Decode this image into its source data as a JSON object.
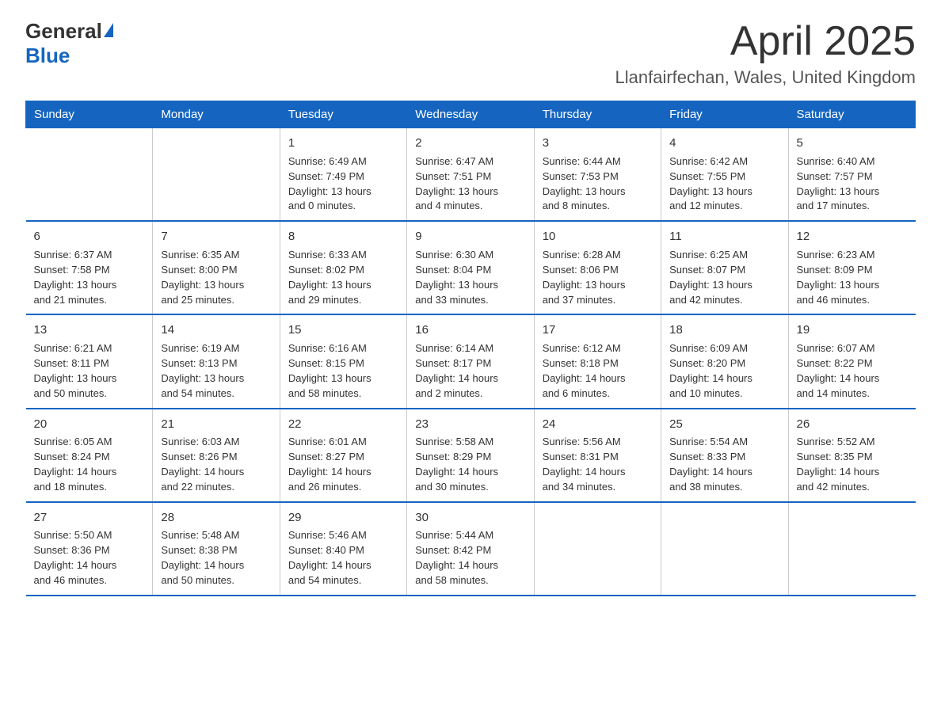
{
  "logo": {
    "general": "General",
    "blue": "Blue"
  },
  "header": {
    "month": "April 2025",
    "location": "Llanfairfechan, Wales, United Kingdom"
  },
  "weekdays": [
    "Sunday",
    "Monday",
    "Tuesday",
    "Wednesday",
    "Thursday",
    "Friday",
    "Saturday"
  ],
  "weeks": [
    [
      {
        "day": "",
        "info": ""
      },
      {
        "day": "",
        "info": ""
      },
      {
        "day": "1",
        "info": "Sunrise: 6:49 AM\nSunset: 7:49 PM\nDaylight: 13 hours\nand 0 minutes."
      },
      {
        "day": "2",
        "info": "Sunrise: 6:47 AM\nSunset: 7:51 PM\nDaylight: 13 hours\nand 4 minutes."
      },
      {
        "day": "3",
        "info": "Sunrise: 6:44 AM\nSunset: 7:53 PM\nDaylight: 13 hours\nand 8 minutes."
      },
      {
        "day": "4",
        "info": "Sunrise: 6:42 AM\nSunset: 7:55 PM\nDaylight: 13 hours\nand 12 minutes."
      },
      {
        "day": "5",
        "info": "Sunrise: 6:40 AM\nSunset: 7:57 PM\nDaylight: 13 hours\nand 17 minutes."
      }
    ],
    [
      {
        "day": "6",
        "info": "Sunrise: 6:37 AM\nSunset: 7:58 PM\nDaylight: 13 hours\nand 21 minutes."
      },
      {
        "day": "7",
        "info": "Sunrise: 6:35 AM\nSunset: 8:00 PM\nDaylight: 13 hours\nand 25 minutes."
      },
      {
        "day": "8",
        "info": "Sunrise: 6:33 AM\nSunset: 8:02 PM\nDaylight: 13 hours\nand 29 minutes."
      },
      {
        "day": "9",
        "info": "Sunrise: 6:30 AM\nSunset: 8:04 PM\nDaylight: 13 hours\nand 33 minutes."
      },
      {
        "day": "10",
        "info": "Sunrise: 6:28 AM\nSunset: 8:06 PM\nDaylight: 13 hours\nand 37 minutes."
      },
      {
        "day": "11",
        "info": "Sunrise: 6:25 AM\nSunset: 8:07 PM\nDaylight: 13 hours\nand 42 minutes."
      },
      {
        "day": "12",
        "info": "Sunrise: 6:23 AM\nSunset: 8:09 PM\nDaylight: 13 hours\nand 46 minutes."
      }
    ],
    [
      {
        "day": "13",
        "info": "Sunrise: 6:21 AM\nSunset: 8:11 PM\nDaylight: 13 hours\nand 50 minutes."
      },
      {
        "day": "14",
        "info": "Sunrise: 6:19 AM\nSunset: 8:13 PM\nDaylight: 13 hours\nand 54 minutes."
      },
      {
        "day": "15",
        "info": "Sunrise: 6:16 AM\nSunset: 8:15 PM\nDaylight: 13 hours\nand 58 minutes."
      },
      {
        "day": "16",
        "info": "Sunrise: 6:14 AM\nSunset: 8:17 PM\nDaylight: 14 hours\nand 2 minutes."
      },
      {
        "day": "17",
        "info": "Sunrise: 6:12 AM\nSunset: 8:18 PM\nDaylight: 14 hours\nand 6 minutes."
      },
      {
        "day": "18",
        "info": "Sunrise: 6:09 AM\nSunset: 8:20 PM\nDaylight: 14 hours\nand 10 minutes."
      },
      {
        "day": "19",
        "info": "Sunrise: 6:07 AM\nSunset: 8:22 PM\nDaylight: 14 hours\nand 14 minutes."
      }
    ],
    [
      {
        "day": "20",
        "info": "Sunrise: 6:05 AM\nSunset: 8:24 PM\nDaylight: 14 hours\nand 18 minutes."
      },
      {
        "day": "21",
        "info": "Sunrise: 6:03 AM\nSunset: 8:26 PM\nDaylight: 14 hours\nand 22 minutes."
      },
      {
        "day": "22",
        "info": "Sunrise: 6:01 AM\nSunset: 8:27 PM\nDaylight: 14 hours\nand 26 minutes."
      },
      {
        "day": "23",
        "info": "Sunrise: 5:58 AM\nSunset: 8:29 PM\nDaylight: 14 hours\nand 30 minutes."
      },
      {
        "day": "24",
        "info": "Sunrise: 5:56 AM\nSunset: 8:31 PM\nDaylight: 14 hours\nand 34 minutes."
      },
      {
        "day": "25",
        "info": "Sunrise: 5:54 AM\nSunset: 8:33 PM\nDaylight: 14 hours\nand 38 minutes."
      },
      {
        "day": "26",
        "info": "Sunrise: 5:52 AM\nSunset: 8:35 PM\nDaylight: 14 hours\nand 42 minutes."
      }
    ],
    [
      {
        "day": "27",
        "info": "Sunrise: 5:50 AM\nSunset: 8:36 PM\nDaylight: 14 hours\nand 46 minutes."
      },
      {
        "day": "28",
        "info": "Sunrise: 5:48 AM\nSunset: 8:38 PM\nDaylight: 14 hours\nand 50 minutes."
      },
      {
        "day": "29",
        "info": "Sunrise: 5:46 AM\nSunset: 8:40 PM\nDaylight: 14 hours\nand 54 minutes."
      },
      {
        "day": "30",
        "info": "Sunrise: 5:44 AM\nSunset: 8:42 PM\nDaylight: 14 hours\nand 58 minutes."
      },
      {
        "day": "",
        "info": ""
      },
      {
        "day": "",
        "info": ""
      },
      {
        "day": "",
        "info": ""
      }
    ]
  ]
}
